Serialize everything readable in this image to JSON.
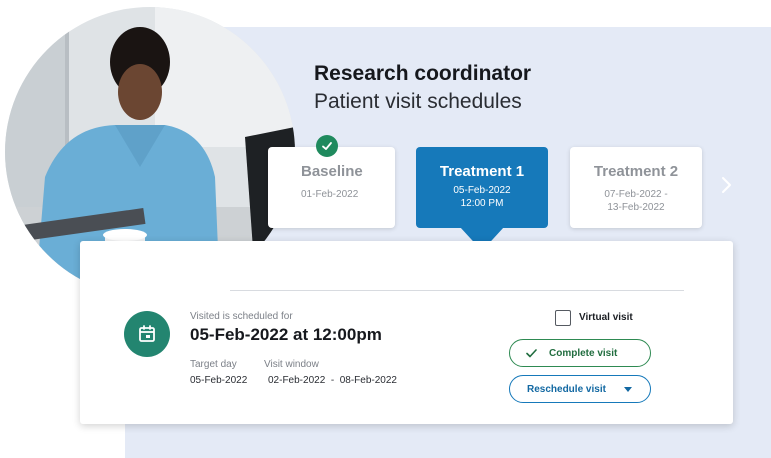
{
  "header": {
    "title": "Research coordinator",
    "subtitle": "Patient visit schedules"
  },
  "visits": [
    {
      "name": "Baseline",
      "date": "01-Feb-2022",
      "completed": true
    },
    {
      "name": "Treatment 1",
      "date": "05-Feb-2022",
      "time": "12:00 PM",
      "selected": true
    },
    {
      "name": "Treatment 2",
      "date_range_start": "07-Feb-2022 -",
      "date_range_end": "13-Feb-2022"
    }
  ],
  "detail": {
    "scheduled_label": "Visited is scheduled for",
    "scheduled_value": "05-Feb-2022 at 12:00pm",
    "target_day_label": "Target day",
    "target_day_value": "05-Feb-2022",
    "visit_window_label": "Visit window",
    "visit_window_value": "02-Feb-2022  -  08-Feb-2022",
    "virtual_visit_label": "Virtual visit",
    "virtual_visit_checked": false,
    "complete_button": "Complete visit",
    "reschedule_button": "Reschedule visit"
  },
  "colors": {
    "accent_blue": "#1679ba",
    "success_green": "#2e8a52",
    "calendar_teal": "#238570",
    "background_panel": "#e4eaf6"
  },
  "icons": {
    "completed": "check-icon",
    "calendar": "calendar-icon",
    "next": "chevron-right-icon",
    "dropdown": "caret-down-icon",
    "complete": "check-icon"
  }
}
